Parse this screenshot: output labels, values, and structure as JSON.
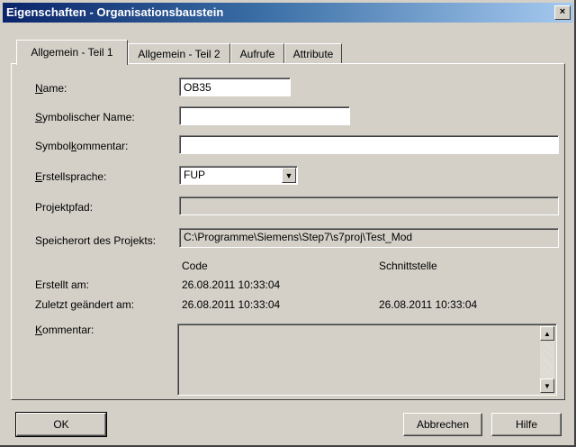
{
  "window": {
    "title": "Eigenschaften - Organisationsbaustein",
    "close_glyph": "×"
  },
  "tabs": [
    {
      "label": "Allgemein - Teil 1",
      "active": true
    },
    {
      "label": "Allgemein - Teil 2",
      "active": false
    },
    {
      "label": "Aufrufe",
      "active": false
    },
    {
      "label": "Attribute",
      "active": false
    }
  ],
  "form": {
    "name": {
      "label_access": "N",
      "label_rest": "ame:",
      "value": "OB35"
    },
    "symbolic_name": {
      "label_access": "S",
      "label_rest": "ymbolischer Name:",
      "value": ""
    },
    "symbol_comment": {
      "label_pre": "Symbol",
      "label_access": "k",
      "label_rest": "ommentar:",
      "value": ""
    },
    "language": {
      "label_access": "E",
      "label_rest": "rstellsprache:",
      "value": "FUP"
    },
    "project_path": {
      "label": "Projektpfad:",
      "value": ""
    },
    "storage_location": {
      "label": "Speicherort des Projekts:",
      "value": "C:\\Programme\\Siemens\\Step7\\s7proj\\Test_Mod"
    },
    "columns": {
      "code": "Code",
      "interface": "Schnittstelle"
    },
    "created": {
      "label": "Erstellt am:",
      "code": "26.08.2011 10:33:04",
      "interface": ""
    },
    "modified": {
      "label": "Zuletzt geändert am:",
      "code": "26.08.2011 10:33:04",
      "interface": "26.08.2011 10:33:04"
    },
    "comment": {
      "label_access": "K",
      "label_rest": "ommentar:",
      "value": ""
    }
  },
  "buttons": {
    "ok": "OK",
    "cancel": "Abbrechen",
    "help": "Hilfe"
  },
  "colors": {
    "title_bar_start": "#0a246a",
    "title_bar_end": "#a6caf0",
    "dialog_face": "#d4d0c8"
  }
}
